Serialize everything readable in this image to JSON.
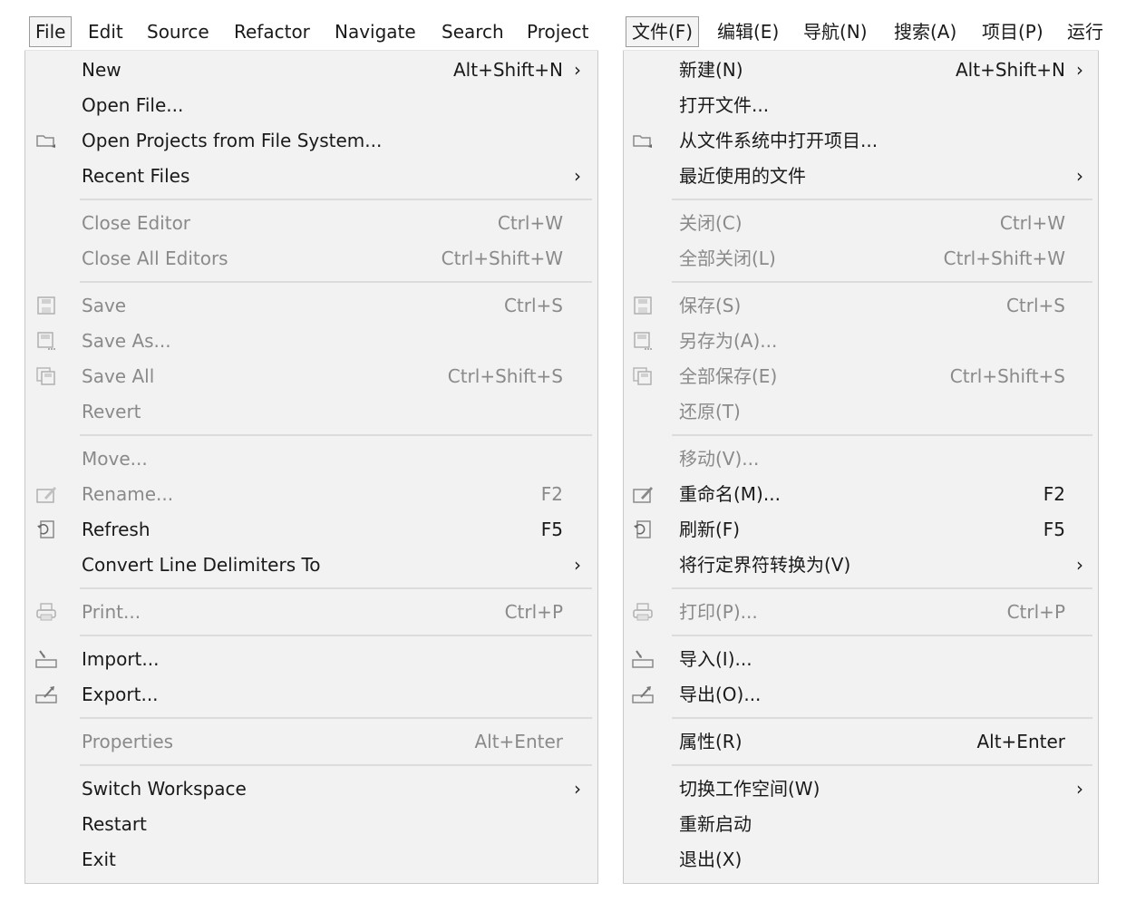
{
  "english": {
    "menubar": [
      "File",
      "Edit",
      "Source",
      "Refactor",
      "Navigate",
      "Search",
      "Project"
    ],
    "items": [
      {
        "label": "New",
        "accel": "Alt+Shift+N",
        "submenu": true
      },
      {
        "label": "Open File...",
        "accel": ""
      },
      {
        "label": "Open Projects from File System...",
        "accel": "",
        "icon": "folder-icon"
      },
      {
        "label": "Recent Files",
        "accel": "",
        "submenu": true
      },
      {
        "label": "Close Editor",
        "accel": "Ctrl+W",
        "disabled": true
      },
      {
        "label": "Close All Editors",
        "accel": "Ctrl+Shift+W",
        "disabled": true
      },
      {
        "label": "Save",
        "accel": "Ctrl+S",
        "disabled": true,
        "icon": "save-icon"
      },
      {
        "label": "Save As...",
        "accel": "",
        "disabled": true,
        "icon": "save-as-icon"
      },
      {
        "label": "Save All",
        "accel": "Ctrl+Shift+S",
        "disabled": true,
        "icon": "save-all-icon"
      },
      {
        "label": "Revert",
        "accel": "",
        "disabled": true
      },
      {
        "label": "Move...",
        "accel": "",
        "disabled": true
      },
      {
        "label": "Rename...",
        "accel": "F2",
        "disabled": true,
        "icon": "rename-icon"
      },
      {
        "label": "Refresh",
        "accel": "F5",
        "icon": "refresh-icon"
      },
      {
        "label": "Convert Line Delimiters To",
        "accel": "",
        "submenu": true
      },
      {
        "label": "Print...",
        "accel": "Ctrl+P",
        "disabled": true,
        "icon": "print-icon"
      },
      {
        "label": "Import...",
        "accel": "",
        "icon": "import-icon"
      },
      {
        "label": "Export...",
        "accel": "",
        "icon": "export-icon"
      },
      {
        "label": "Properties",
        "accel": "Alt+Enter",
        "disabled": true
      },
      {
        "label": "Switch Workspace",
        "accel": "",
        "submenu": true
      },
      {
        "label": "Restart",
        "accel": ""
      },
      {
        "label": "Exit",
        "accel": ""
      }
    ]
  },
  "chinese": {
    "menubar": [
      "文件(F)",
      "编辑(E)",
      "导航(N)",
      "搜索(A)",
      "项目(P)",
      "运行"
    ],
    "items": [
      {
        "label": "新建(N)",
        "accel": "Alt+Shift+N",
        "submenu": true
      },
      {
        "label": "打开文件...",
        "accel": ""
      },
      {
        "label": "从文件系统中打开项目...",
        "accel": "",
        "icon": "folder-icon"
      },
      {
        "label": "最近使用的文件",
        "accel": "",
        "submenu": true
      },
      {
        "label": "关闭(C)",
        "accel": "Ctrl+W",
        "disabled": true
      },
      {
        "label": "全部关闭(L)",
        "accel": "Ctrl+Shift+W",
        "disabled": true
      },
      {
        "label": "保存(S)",
        "accel": "Ctrl+S",
        "disabled": true,
        "icon": "save-icon"
      },
      {
        "label": "另存为(A)...",
        "accel": "",
        "disabled": true,
        "icon": "save-as-icon"
      },
      {
        "label": "全部保存(E)",
        "accel": "Ctrl+Shift+S",
        "disabled": true,
        "icon": "save-all-icon"
      },
      {
        "label": "还原(T)",
        "accel": "",
        "disabled": true
      },
      {
        "label": "移动(V)...",
        "accel": "",
        "disabled": true
      },
      {
        "label": "重命名(M)...",
        "accel": "F2",
        "icon": "rename-icon"
      },
      {
        "label": "刷新(F)",
        "accel": "F5",
        "icon": "refresh-icon"
      },
      {
        "label": "将行定界符转换为(V)",
        "accel": "",
        "submenu": true
      },
      {
        "label": "打印(P)...",
        "accel": "Ctrl+P",
        "disabled": true,
        "icon": "print-icon"
      },
      {
        "label": "导入(I)...",
        "accel": "",
        "icon": "import-icon"
      },
      {
        "label": "导出(O)...",
        "accel": "",
        "icon": "export-icon"
      },
      {
        "label": "属性(R)",
        "accel": "Alt+Enter"
      },
      {
        "label": "切换工作空间(W)",
        "accel": "",
        "submenu": true
      },
      {
        "label": "重新启动",
        "accel": ""
      },
      {
        "label": "退出(X)",
        "accel": ""
      }
    ]
  },
  "submenu_glyph": "›"
}
